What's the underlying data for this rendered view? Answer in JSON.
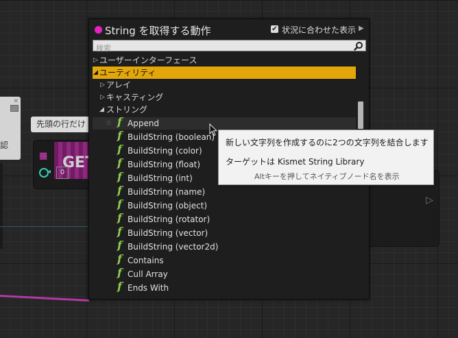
{
  "graph": {
    "comment_text": "先頭の行だけ",
    "left_node_text": "認",
    "get_node": {
      "title": "GET",
      "index_value": "0"
    }
  },
  "menu": {
    "title": "String を取得する動作",
    "context_sensitive_label": "状況に合わせた表示",
    "context_sensitive_checked": true,
    "search": {
      "placeholder": "検索",
      "value": ""
    },
    "categories": [
      {
        "label": "ユーザーインターフェース",
        "expanded": false
      },
      {
        "label": "ユーティリティ",
        "expanded": true,
        "selected": true
      },
      {
        "label": "アレイ",
        "expanded": false
      },
      {
        "label": "キャスティング",
        "expanded": false
      },
      {
        "label": "ストリング",
        "expanded": true
      }
    ],
    "functions": [
      {
        "label": "Append",
        "hovered": true
      },
      {
        "label": "BuildString (boolean)"
      },
      {
        "label": "BuildString (color)"
      },
      {
        "label": "BuildString (float)"
      },
      {
        "label": "BuildString (int)"
      },
      {
        "label": "BuildString (name)"
      },
      {
        "label": "BuildString (object)"
      },
      {
        "label": "BuildString (rotator)"
      },
      {
        "label": "BuildString (vector)"
      },
      {
        "label": "BuildString (vector2d)"
      },
      {
        "label": "Contains"
      },
      {
        "label": "Cull Array"
      },
      {
        "label": "Ends With"
      }
    ]
  },
  "tooltip": {
    "description": "新しい文字列を作成するのに2つの文字列を結合します",
    "target": "ターゲットは Kismet String Library",
    "hint": "Altキーを押してネイティブノード名を表示"
  },
  "colors": {
    "selection": "#e3a70a",
    "function_icon": "#8fd150",
    "string_pin": "#e820c8"
  },
  "icons": {
    "function": "f",
    "star": "☆",
    "expanded": "◢",
    "collapsed": "▷"
  }
}
